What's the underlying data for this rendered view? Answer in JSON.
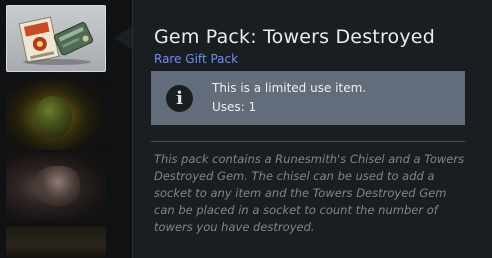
{
  "inventory": {
    "selected_item_icon": "gem-pack-icon",
    "other_items": [
      "gem-icon",
      "figure-icon",
      "item-icon"
    ]
  },
  "tooltip": {
    "title": "Gem Pack: Towers Destroyed",
    "rarity": "Rare Gift Pack",
    "rarity_color": "#6b8cff",
    "info": {
      "icon": "info-icon",
      "line1": "This is a limited use item.",
      "line2": "Uses: 1"
    },
    "description": "This pack contains a Runesmith's Chisel and a Towers Destroyed Gem. The chisel can be used to add a socket to any item and the Towers Destroyed Gem can be placed in a socket to count the number of towers you have destroyed."
  }
}
